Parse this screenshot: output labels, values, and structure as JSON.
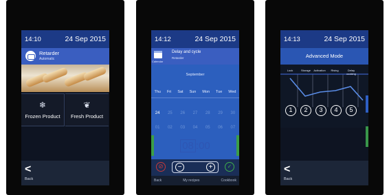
{
  "screen1": {
    "time": "14:10",
    "date": "24 Sep 2015",
    "header_title": "Retarder",
    "header_subtitle": "Automatic",
    "buttons": [
      {
        "label": "Frozen Product",
        "icon": "snowflake-icon"
      },
      {
        "label": "Fresh Product",
        "icon": "leaf-icon"
      }
    ],
    "back_label": "Back"
  },
  "screen2": {
    "time": "14:12",
    "date": "24 Sep 2015",
    "calendar_label": "Calendar",
    "header_title": "Delay and cycle",
    "header_subtitle": "Retarder",
    "month": "September",
    "daynames": [
      "Thu",
      "Fri",
      "Sat",
      "Sun",
      "Mon",
      "Tue",
      "Wed"
    ],
    "row1": [
      "24",
      "25",
      "26",
      "27",
      "28",
      "29",
      "30"
    ],
    "row2": [
      "01",
      "02",
      "03",
      "04",
      "05",
      "06",
      "07"
    ],
    "time_hours": "08",
    "time_minutes": ":00",
    "minus_symbol": "−",
    "plus_symbol": "+",
    "tabs": [
      "Back",
      "My recipes",
      "Cookbook"
    ]
  },
  "screen3": {
    "time": "14:13",
    "date": "24 Sep 2015",
    "title": "Advanced Mode",
    "stages": [
      "Lock",
      "Storage",
      "Activation",
      "Rising",
      "Delay cooking"
    ],
    "steps": [
      "1",
      "2",
      "3",
      "4",
      "5"
    ],
    "back_label": "Back"
  },
  "colors": {
    "statusbar": "#1c3a86",
    "header": "#3a5ec0",
    "calendar": "#2c5fbe",
    "cancel": "#c53a3a",
    "confirm": "#3fae4b"
  }
}
